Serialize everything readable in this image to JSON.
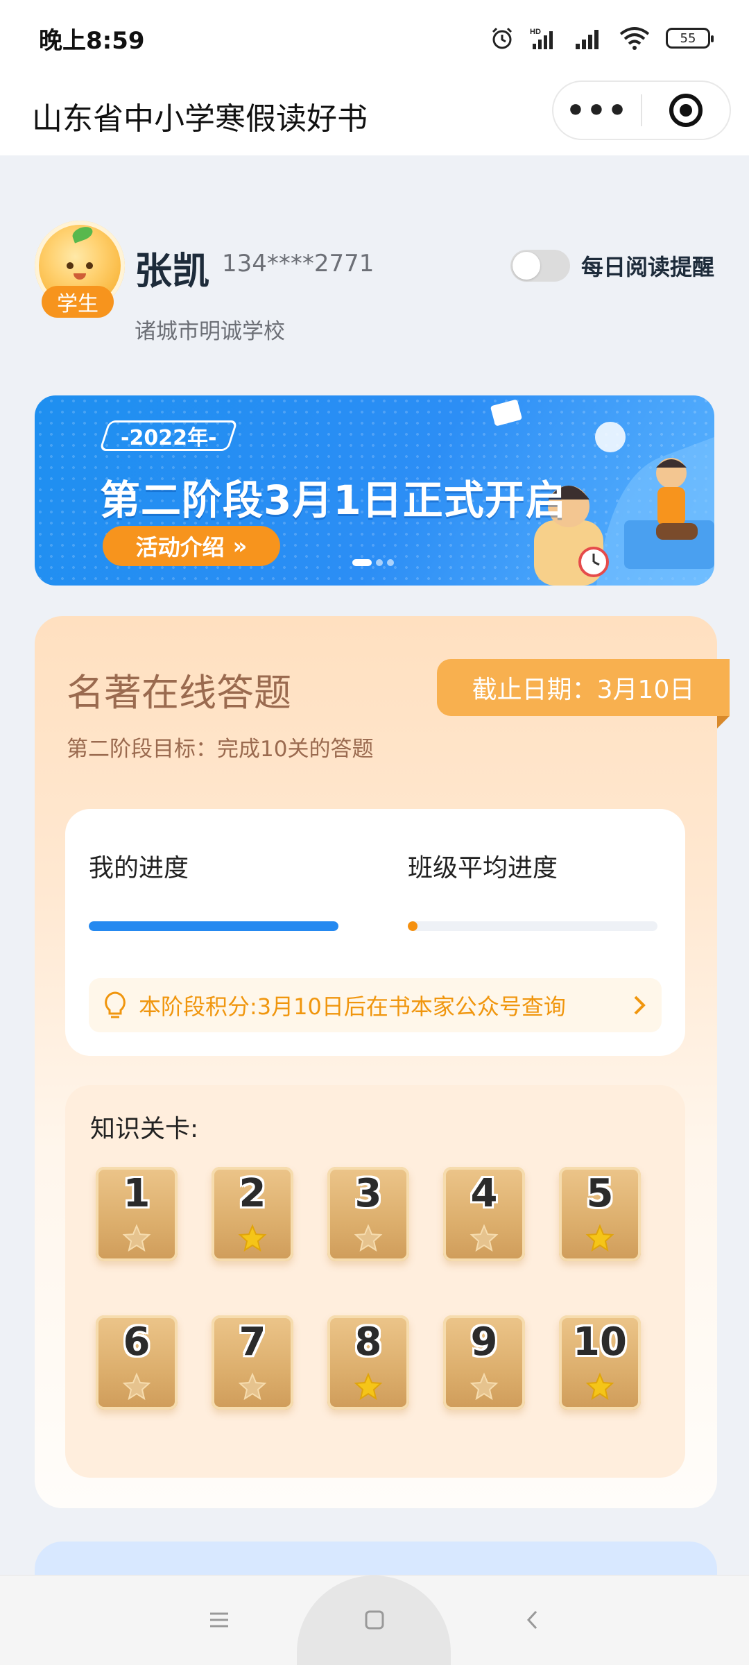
{
  "status_bar": {
    "time": "晚上8:59",
    "battery": "55"
  },
  "title_bar": {
    "title": "山东省中小学寒假读好书",
    "more_label": "•••"
  },
  "profile": {
    "role": "学生",
    "name": "张凯",
    "phone": "134****2771",
    "school": "诸城市明诚学校",
    "reminder_label": "每日阅读提醒",
    "reminder_enabled": false
  },
  "banner": {
    "year": "-2022年-",
    "headline": "第二阶段3月1日正式开启",
    "button": "活动介绍",
    "button_arrow": "»",
    "slide_count": 3,
    "active_slide": 0
  },
  "quiz": {
    "title": "名著在线答题",
    "deadline": "截止日期：3月10日",
    "goal": "第二阶段目标：完成10关的答题",
    "my_progress_label": "我的进度",
    "class_progress_label": "班级平均进度",
    "my_progress": 1.0,
    "class_progress": 0.02,
    "score_tip": "本阶段积分:3月10日后在书本家公众号查询",
    "levels_label": "知识关卡:",
    "levels": [
      {
        "number": "1",
        "star": false
      },
      {
        "number": "2",
        "star": true
      },
      {
        "number": "3",
        "star": false
      },
      {
        "number": "4",
        "star": false
      },
      {
        "number": "5",
        "star": true
      },
      {
        "number": "6",
        "star": false
      },
      {
        "number": "7",
        "star": false
      },
      {
        "number": "8",
        "star": true
      },
      {
        "number": "9",
        "star": false
      },
      {
        "number": "10",
        "star": true
      }
    ]
  },
  "colors": {
    "accent_blue": "#2589f0",
    "accent_orange": "#f7941d",
    "star_gold": "#f5c518",
    "star_empty": "#e6c38e"
  }
}
